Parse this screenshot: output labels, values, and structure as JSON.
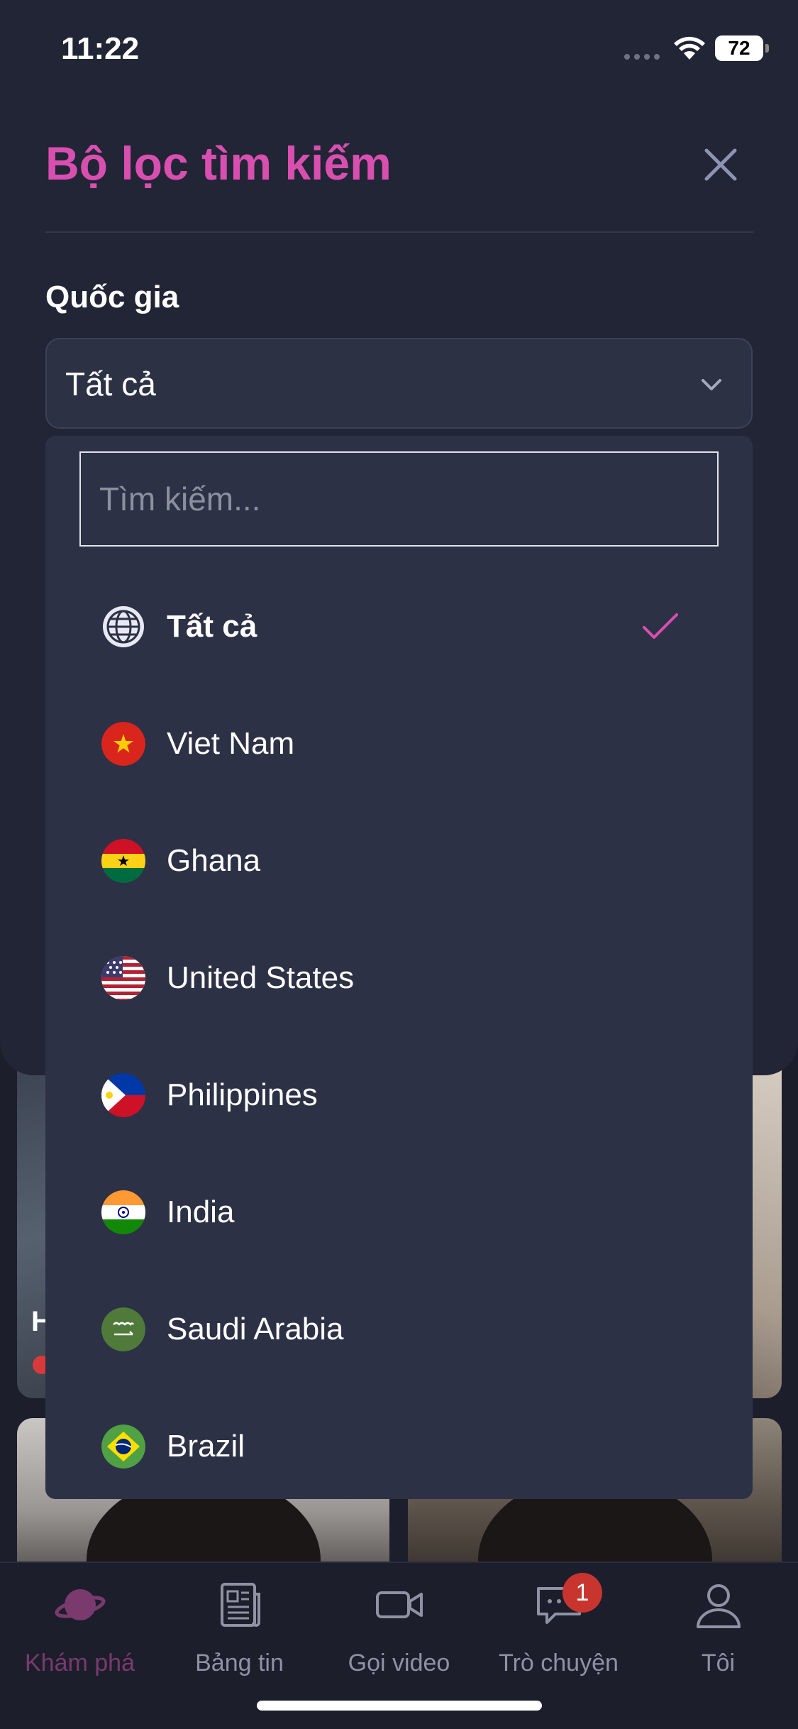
{
  "status_bar": {
    "time": "11:22",
    "battery": "72"
  },
  "filter_sheet": {
    "title": "Bộ lọc tìm kiếm",
    "country_label": "Quốc gia",
    "selected_country": "Tất cả",
    "search_placeholder": "Tìm kiếm...",
    "options": [
      {
        "label": "Tất cả",
        "icon": "globe-icon",
        "selected": true
      },
      {
        "label": "Viet Nam",
        "icon": "vietnam-flag-icon",
        "selected": false
      },
      {
        "label": "Ghana",
        "icon": "ghana-flag-icon",
        "selected": false
      },
      {
        "label": "United States",
        "icon": "usa-flag-icon",
        "selected": false
      },
      {
        "label": "Philippines",
        "icon": "philippines-flag-icon",
        "selected": false
      },
      {
        "label": "India",
        "icon": "india-flag-icon",
        "selected": false
      },
      {
        "label": "Saudi Arabia",
        "icon": "saudi-arabia-flag-icon",
        "selected": false
      },
      {
        "label": "Brazil",
        "icon": "brazil-flag-icon",
        "selected": false
      }
    ]
  },
  "tab_bar": {
    "items": [
      {
        "label": "Khám phá",
        "icon": "planet-icon",
        "active": true
      },
      {
        "label": "Bảng tin",
        "icon": "newspaper-icon",
        "active": false
      },
      {
        "label": "Gọi video",
        "icon": "video-camera-icon",
        "active": false
      },
      {
        "label": "Trò chuyện",
        "icon": "chat-icon",
        "active": false,
        "badge": "1"
      },
      {
        "label": "Tôi",
        "icon": "profile-icon",
        "active": false
      }
    ]
  },
  "colors": {
    "accent": "#d84fb0",
    "sheet_bg": "#222536",
    "dropdown_bg": "#2d3145",
    "badge": "#c8352e"
  }
}
